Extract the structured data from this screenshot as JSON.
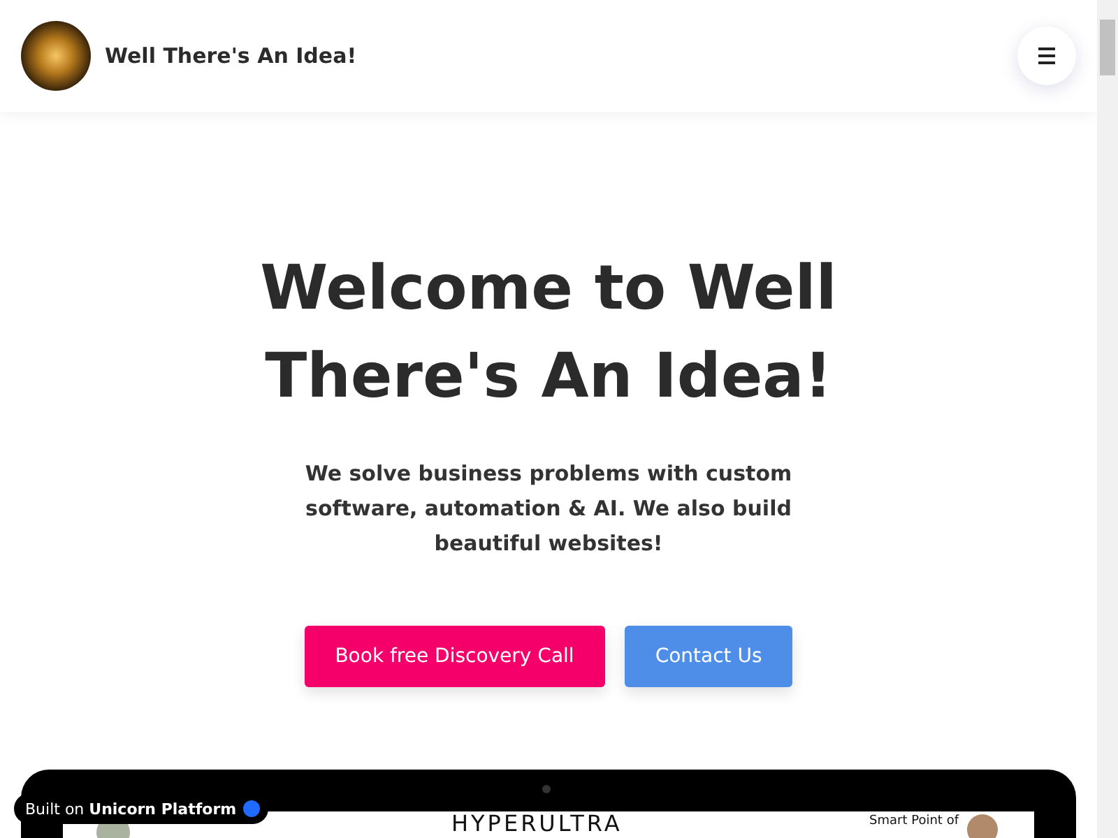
{
  "header": {
    "site_name": "Well There's An Idea!"
  },
  "hero": {
    "title": "Welcome to Well There's An Idea!",
    "subtitle": "We solve business problems with custom software, automation & AI. We also build beautiful websites!",
    "buttons": [
      {
        "label": "Book free Discovery Call",
        "kind": "primary"
      },
      {
        "label": "Contact Us",
        "kind": "secondary"
      }
    ]
  },
  "preview": {
    "brand": "HYPERULTRA",
    "side_text": "Smart Point of"
  },
  "badge": {
    "text": "Built on **Unicorn Platform**"
  }
}
